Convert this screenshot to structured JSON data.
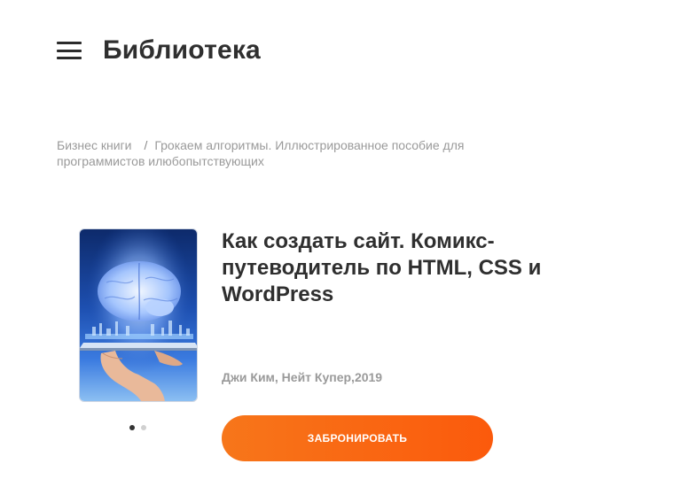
{
  "header": {
    "menu_icon": "hamburger-menu-icon",
    "title": "Библиотека"
  },
  "breadcrumb": {
    "items": [
      {
        "label": "Бизнес книги"
      },
      {
        "label": "Грокаем алгоритмы. Иллюстрированное пособие для программистов илюбопытствующих"
      }
    ],
    "separator": "/"
  },
  "book": {
    "cover_image": "brain-over-hand-tablet-cover",
    "title": "Как создать сайт. Комикс-путеводитель по HTML, CSS и WordPress",
    "meta": "Джи Ким, Нейт Купер,2019",
    "carousel": {
      "total": 2,
      "active": 1
    }
  },
  "actions": {
    "reserve_label": "ЗАБРОНИРОВАТЬ"
  },
  "colors": {
    "accent_start": "#f7761a",
    "accent_end": "#fb5a0c",
    "text_dark": "#2f2f2f",
    "text_muted": "#9a9a9a"
  }
}
